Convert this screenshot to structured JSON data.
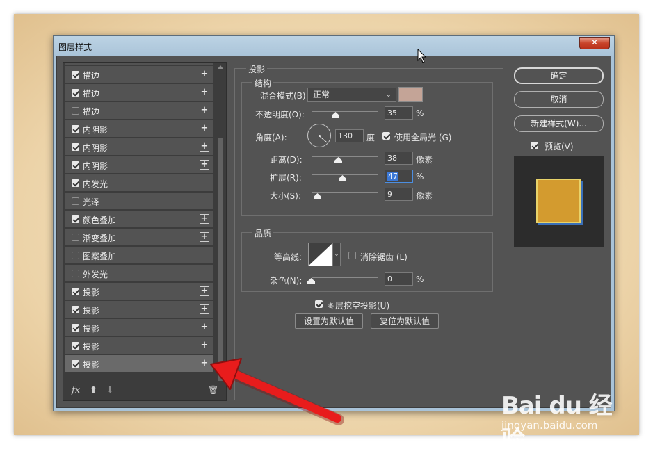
{
  "window": {
    "title": "图层样式",
    "close_label": "✕"
  },
  "effects": [
    {
      "label": "",
      "checked": false,
      "plus": false,
      "partial": true
    },
    {
      "label": "描边",
      "checked": true,
      "plus": true
    },
    {
      "label": "描边",
      "checked": true,
      "plus": true
    },
    {
      "label": "描边",
      "checked": false,
      "plus": true
    },
    {
      "label": "内阴影",
      "checked": true,
      "plus": true
    },
    {
      "label": "内阴影",
      "checked": true,
      "plus": true
    },
    {
      "label": "内阴影",
      "checked": true,
      "plus": true
    },
    {
      "label": "内发光",
      "checked": true,
      "plus": false
    },
    {
      "label": "光泽",
      "checked": false,
      "plus": false
    },
    {
      "label": "颜色叠加",
      "checked": true,
      "plus": true
    },
    {
      "label": "渐变叠加",
      "checked": false,
      "plus": true
    },
    {
      "label": "图案叠加",
      "checked": false,
      "plus": false
    },
    {
      "label": "外发光",
      "checked": false,
      "plus": false
    },
    {
      "label": "投影",
      "checked": true,
      "plus": true
    },
    {
      "label": "投影",
      "checked": true,
      "plus": true
    },
    {
      "label": "投影",
      "checked": true,
      "plus": true
    },
    {
      "label": "投影",
      "checked": true,
      "plus": true
    },
    {
      "label": "投影",
      "checked": true,
      "plus": true,
      "selected": true
    }
  ],
  "tools": {
    "fx": "fx",
    "up": "⬆",
    "down": "⬇",
    "trash": "🗑"
  },
  "drop_shadow": {
    "title": "投影",
    "structure": {
      "title": "结构",
      "blend_mode_label": "混合模式(B):",
      "blend_mode_value": "正常",
      "shadow_color": "#c4a497",
      "opacity_label": "不透明度(O):",
      "opacity_value": "35",
      "opacity_unit": "%",
      "opacity_level": 0.35,
      "angle_label": "角度(A):",
      "angle_value": "130",
      "angle_unit": "度",
      "global_light_label": "使用全局光 (G)",
      "global_light_checked": true,
      "distance_label": "距离(D):",
      "distance_value": "38",
      "distance_unit": "像素",
      "spread_label": "扩展(R):",
      "spread_value": "47",
      "spread_unit": "%",
      "size_label": "大小(S):",
      "size_value": "9",
      "size_unit": "像素"
    },
    "quality": {
      "title": "品质",
      "contour_label": "等高线:",
      "anti_alias_label": "消除锯齿 (L)",
      "anti_alias_checked": false,
      "noise_label": "杂色(N):",
      "noise_value": "0",
      "noise_unit": "%"
    },
    "knockout_label": "图层挖空投影(U)",
    "knockout_checked": true,
    "make_default_label": "设置为默认值",
    "reset_default_label": "复位为默认值"
  },
  "buttons": {
    "ok": "确定",
    "cancel": "取消",
    "new_style": "新建样式(W)...",
    "preview_label": "预览(V)",
    "preview_checked": true
  },
  "watermark": {
    "logo": "Bai du 经验",
    "url": "jingyan.baidu.com"
  },
  "colors": {
    "preview_fill": "#d39b2f",
    "arrow": "#e81c1c"
  }
}
